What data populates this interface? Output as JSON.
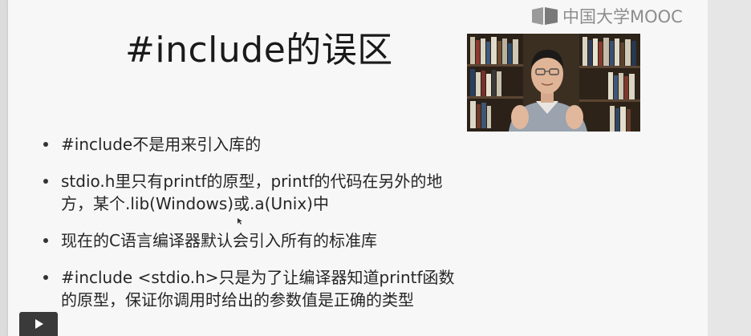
{
  "slide": {
    "title": "#include的误区",
    "bullets": [
      {
        "lines": [
          "#include不是用来引入库的"
        ]
      },
      {
        "lines": [
          "stdio.h里只有printf的原型，printf的代码在另外的地",
          "方，某个.lib(Windows)或.a(Unix)中"
        ]
      },
      {
        "lines": [
          "现在的C语言编译器默认会引入所有的标准库"
        ]
      },
      {
        "lines": [
          "#include <stdio.h>只是为了让编译器知道printf函数",
          "的原型，保证你调用时给出的参数值是正确的类型"
        ]
      }
    ]
  },
  "watermark": {
    "text": "中国大学MOOC"
  },
  "player": {
    "play_icon": "play-icon"
  },
  "colors": {
    "slide_bg": "#f7f7f7",
    "text": "#262626",
    "watermark": "#8d8d8d"
  }
}
